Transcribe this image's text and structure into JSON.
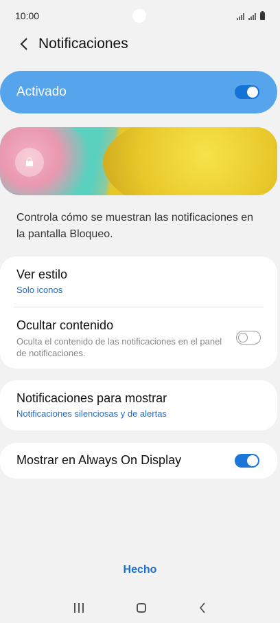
{
  "status_bar": {
    "time": "10:00"
  },
  "header": {
    "title": "Notificaciones"
  },
  "master_toggle": {
    "label": "Activado",
    "state": "on"
  },
  "description": "Controla cómo se muestran las notificaciones en la pantalla Bloqueo.",
  "settings": {
    "view_style": {
      "title": "Ver estilo",
      "value": "Solo iconos"
    },
    "hide_content": {
      "title": "Ocultar contenido",
      "description": "Oculta el contenido de las notificaciones en el panel de notificaciones.",
      "state": "off"
    },
    "notifications_to_show": {
      "title": "Notificaciones para mostrar",
      "value": "Notificaciones silenciosas y de alertas"
    },
    "always_on_display": {
      "title": "Mostrar en Always On Display",
      "state": "on"
    }
  },
  "footer": {
    "done_label": "Hecho"
  },
  "colors": {
    "accent": "#1a6fd3",
    "master_bg": "#56a5ec",
    "background": "#f2f2f2"
  },
  "icons": [
    "back-icon",
    "lock-icon",
    "signal-icon",
    "battery-icon",
    "recent-apps-icon",
    "home-icon",
    "back-nav-icon"
  ]
}
